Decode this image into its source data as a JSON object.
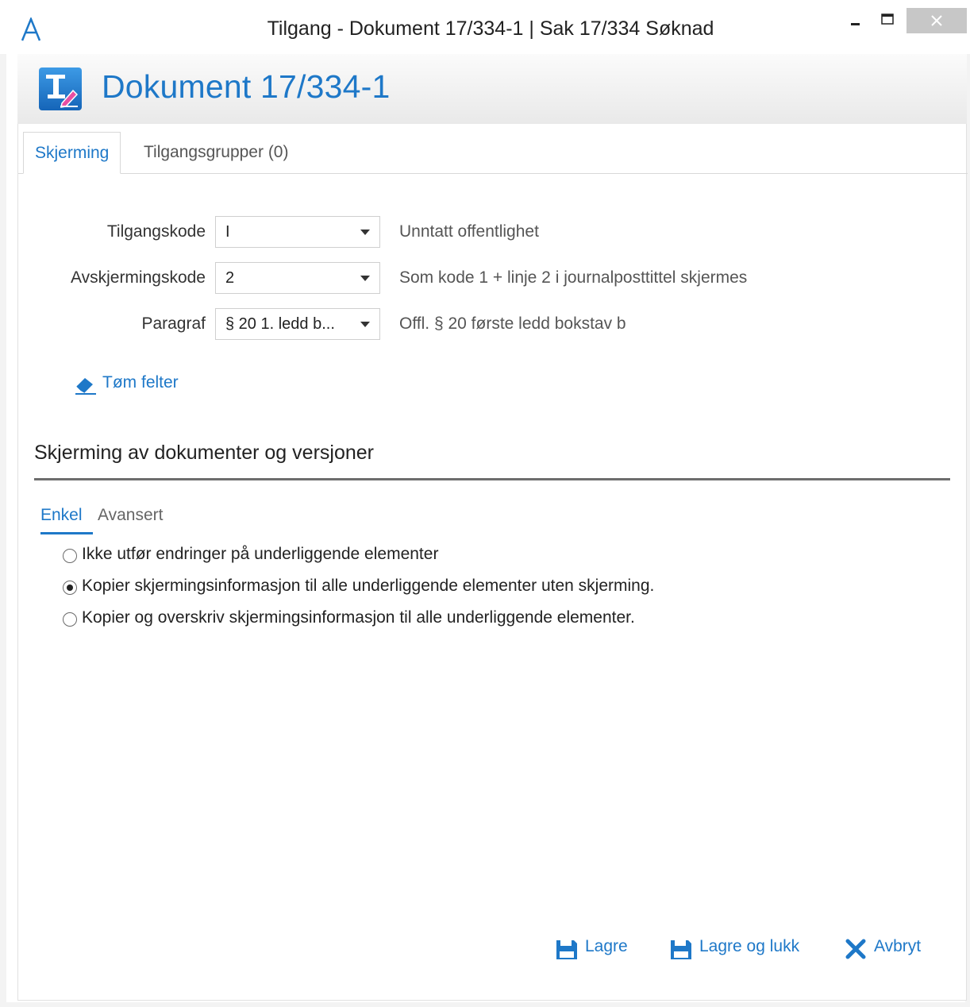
{
  "window": {
    "title": "Tilgang - Dokument 17/334-1 | Sak 17/334 Søknad",
    "minimize_glyph": "–",
    "close_glyph": "×",
    "app_icon": "letter-a-icon"
  },
  "header": {
    "title": "Dokument 17/334-1",
    "icon": "document-edit-icon",
    "icon_color": "#1e78c8"
  },
  "tabs": [
    {
      "label": "Skjerming",
      "active": true
    },
    {
      "label": "Tilgangsgrupper (0)",
      "active": false
    }
  ],
  "form": {
    "tilgangskode": {
      "label": "Tilgangskode",
      "value": "I",
      "description": "Unntatt offentlighet"
    },
    "avskjermingskode": {
      "label": "Avskjermingskode",
      "value": "2",
      "description": "Som kode 1 + linje 2 i journalposttittel skjermes"
    },
    "paragraf": {
      "label": "Paragraf",
      "value": "§ 20 1. ledd b...",
      "description": "Offl. § 20 første ledd bokstav b"
    }
  },
  "clear_fields": {
    "label": "Tøm felter",
    "icon": "eraser-icon"
  },
  "section": {
    "title": "Skjerming av dokumenter og versjoner",
    "subtabs": [
      {
        "label": "Enkel",
        "active": true
      },
      {
        "label": "Avansert",
        "active": false
      }
    ],
    "options": [
      {
        "label": "Ikke utfør endringer på underliggende elementer",
        "checked": false
      },
      {
        "label": "Kopier skjermingsinformasjon til alle underliggende elementer uten skjerming.",
        "checked": true
      },
      {
        "label": "Kopier og overskriv skjermingsinformasjon til alle underliggende elementer.",
        "checked": false
      }
    ]
  },
  "footer": {
    "save": {
      "label": "Lagre",
      "icon": "save-icon"
    },
    "save_close": {
      "label": "Lagre og lukk",
      "icon": "save-icon"
    },
    "cancel": {
      "label": "Avbryt",
      "icon": "close-x-icon"
    }
  },
  "colors": {
    "accent": "#1e78c8",
    "close_button_bg": "#c7c7c7",
    "section_rule": "#6d6d6d"
  }
}
